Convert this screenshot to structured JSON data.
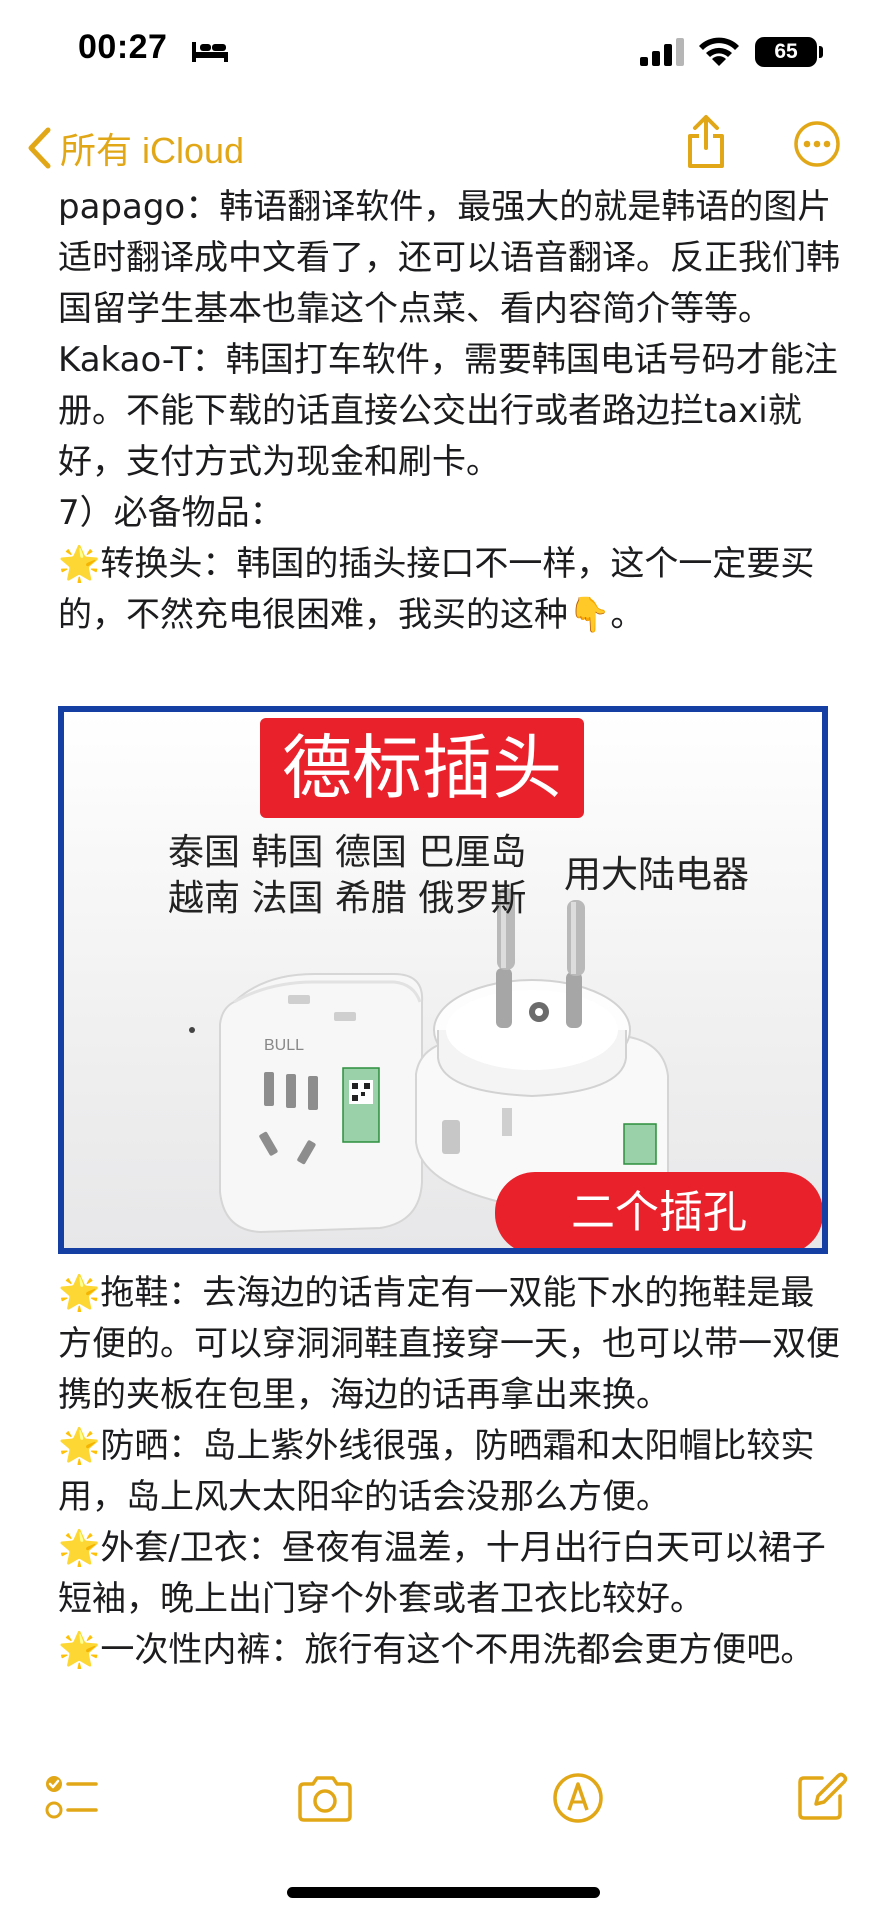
{
  "status_bar": {
    "time": "00:27",
    "battery": "65",
    "icons": [
      "bed-icon",
      "cellular-signal-icon",
      "wifi-icon",
      "battery-icon"
    ]
  },
  "nav": {
    "back_label": "所有 iCloud",
    "icons": [
      "chevron-left-icon",
      "share-icon",
      "more-icon"
    ],
    "accent_color": "#e2a717"
  },
  "note": {
    "paragraphs_top": [
      "papago：韩语翻译软件，最强大的就是韩语的图片适时翻译成中文看了，还可以语音翻译。反正我们韩国留学生基本也靠这个点菜、看内容简介等等。",
      "Kakao-T：韩国打车软件，需要韩国电话号码才能注册。不能下载的话直接公交出行或者路边拦taxi就好，支付方式为现金和刷卡。",
      "7）必备物品：",
      "🌟转换头：韩国的插头接口不一样，这个一定要买的，不然充电很困难，我买的这种👇。"
    ],
    "image": {
      "banner": "德标插头",
      "countries_line1": "泰国 韩国 德国 巴厘岛",
      "countries_line2": "越南 法国 希腊 俄罗斯",
      "use_label": "用大陆电器",
      "holes_label": "二个插孔",
      "brand": "BULL",
      "banner_color": "#e8212b",
      "frame_color": "#153fa3"
    },
    "paragraphs_bottom": [
      "🌟拖鞋：去海边的话肯定有一双能下水的拖鞋是最方便的。可以穿洞洞鞋直接穿一天，也可以带一双便携的夹板在包里，海边的话再拿出来换。",
      "🌟防晒：岛上紫外线很强，防晒霜和太阳帽比较实用，岛上风大太阳伞的话会没那么方便。",
      "🌟外套/卫衣：昼夜有温差，十月出行白天可以裙子短袖，晚上出门穿个外套或者卫衣比较好。",
      "🌟一次性内裤：旅行有这个不用洗都会更方便吧。"
    ]
  },
  "toolbar": {
    "icons": [
      "checklist-icon",
      "camera-icon",
      "markup-pen-icon",
      "compose-icon"
    ]
  }
}
